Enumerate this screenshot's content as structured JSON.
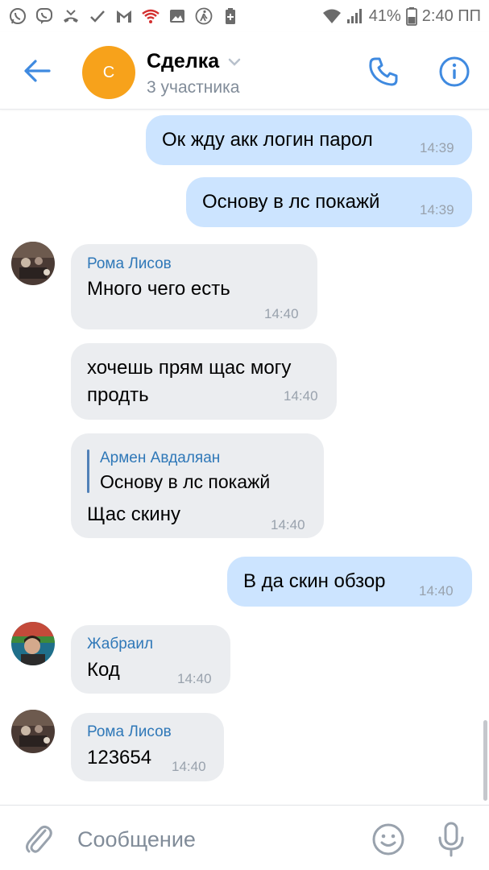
{
  "status_bar": {
    "battery": "41%",
    "time": "2:40 ПП",
    "icons": [
      "whatsapp-icon",
      "viber-icon",
      "missed-call-icon",
      "check-icon",
      "gmail-icon",
      "wifi-alert-icon",
      "gallery-icon",
      "walking-icon",
      "battery-saver-icon"
    ]
  },
  "header": {
    "avatar_letter": "С",
    "title": "Сделка",
    "subtitle": "3 участника"
  },
  "messages": [
    {
      "direction": "out",
      "text": "Ок жду акк логин парол",
      "time": "14:39"
    },
    {
      "direction": "out",
      "text": "Основу в лс покажй",
      "time": "14:39"
    },
    {
      "direction": "in",
      "sender": "Рома Лисов",
      "text": "Много чего есть",
      "time": "14:40"
    },
    {
      "direction": "in",
      "text": "хочешь прям щас могу\nпродть",
      "time": "14:40"
    },
    {
      "direction": "in",
      "reply_author": "Армен Авдаляан",
      "reply_text": "Основу в лс покажй",
      "text": "Щас скину",
      "time": "14:40"
    },
    {
      "direction": "out",
      "text": "В да скин обзор",
      "time": "14:40"
    },
    {
      "direction": "in",
      "sender": "Жабраил",
      "text": "Код",
      "time": "14:40"
    },
    {
      "direction": "in",
      "sender": "Рома Лисов",
      "text": "123654",
      "time": "14:40"
    }
  ],
  "composer": {
    "placeholder": "Сообщение"
  },
  "colors": {
    "accent": "#3f8ae0",
    "outgoing_bubble": "#cce4ff",
    "incoming_bubble": "#ebedf0",
    "avatar_orange": "#f7a21b",
    "sender_name": "#2f78b8"
  }
}
